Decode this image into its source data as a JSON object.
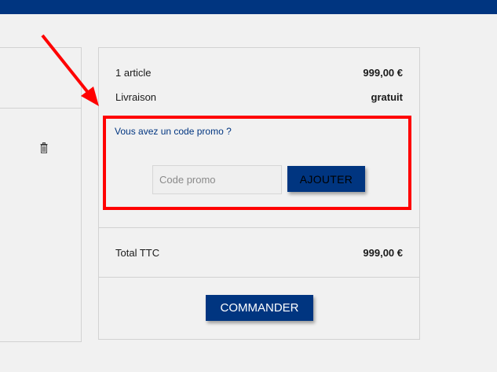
{
  "summary": {
    "items_label": "1 article",
    "items_value": "999,00 €",
    "shipping_label": "Livraison",
    "shipping_value": "gratuit",
    "promo_link": "Vous avez un code promo ?",
    "promo_placeholder": "Code promo",
    "add_button": "AJOUTER",
    "total_label": "Total TTC",
    "total_value": "999,00 €",
    "order_button": "COMMANDER"
  },
  "colors": {
    "brand": "#003580",
    "highlight": "#ff0000",
    "background": "#f1f1f1"
  },
  "icons": {
    "cart_item_action": "trash-icon",
    "annotation": "red-arrow"
  }
}
